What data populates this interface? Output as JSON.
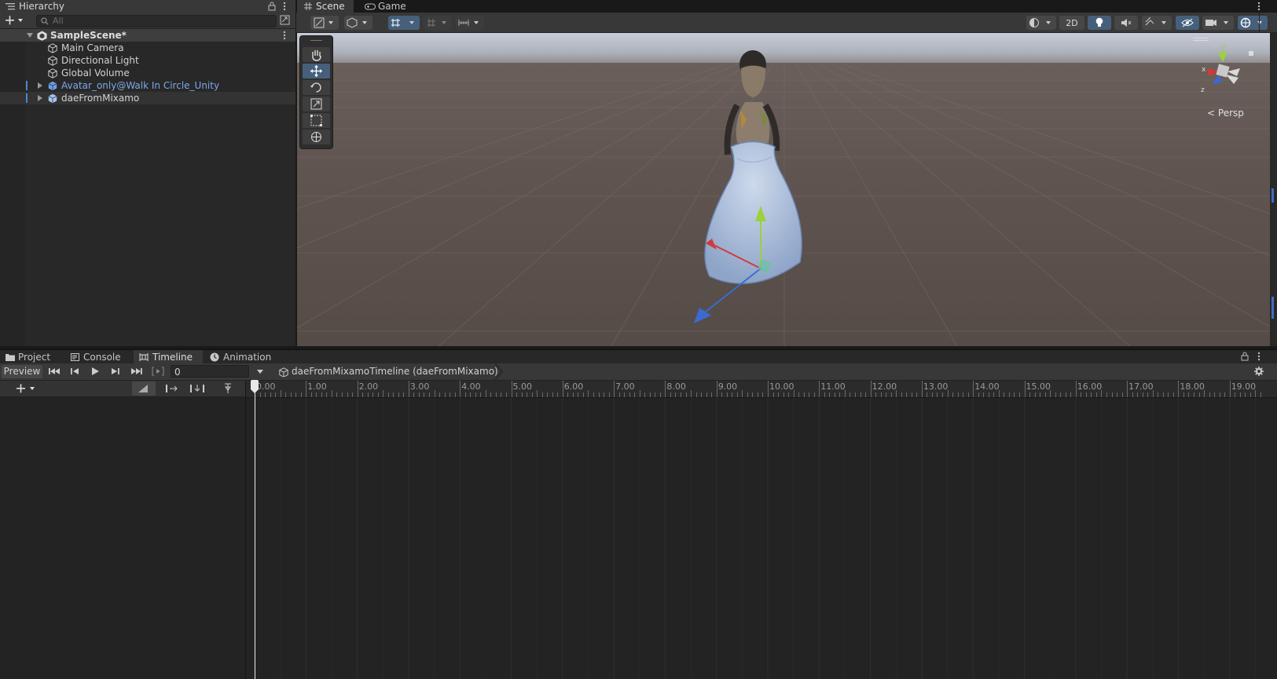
{
  "hierarchy": {
    "title": "Hierarchy",
    "search_placeholder": "All",
    "scene_name": "SampleScene*",
    "items": [
      {
        "label": "Main Camera",
        "style": "normal"
      },
      {
        "label": "Directional Light",
        "style": "normal"
      },
      {
        "label": "Global Volume",
        "style": "normal"
      },
      {
        "label": "Avatar_only@Walk In Circle_Unity",
        "style": "prefab-blue"
      },
      {
        "label": "daeFromMixamo",
        "style": "selected"
      }
    ]
  },
  "scene": {
    "tabs": [
      {
        "label": "Scene",
        "icon": "grid-icon"
      },
      {
        "label": "Game",
        "icon": "gamepad-icon"
      }
    ],
    "toolbar_2d_label": "2D",
    "gizmo_projection_label": "Persp",
    "gizmo_axes": [
      "y",
      "x",
      "z"
    ],
    "tools": [
      "hand-tool",
      "move-tool",
      "rotate-tool",
      "scale-tool",
      "rect-tool",
      "transform-tool"
    ],
    "active_tool": "move-tool"
  },
  "bottom": {
    "tabs": [
      {
        "label": "Project",
        "icon": "folder-icon"
      },
      {
        "label": "Console",
        "icon": "console-icon"
      },
      {
        "label": "Timeline",
        "icon": "timeline-icon"
      },
      {
        "label": "Animation",
        "icon": "animation-icon"
      }
    ],
    "active_tab": "Timeline"
  },
  "timeline": {
    "preview_label": "Preview",
    "frame_value": "0",
    "breadcrumb": "daeFromMixamoTimeline (daeFromMixamo)",
    "ruler_labels": [
      "0.00",
      "1.00",
      "2.00",
      "3.00",
      "4.00",
      "5.00",
      "6.00",
      "7.00",
      "8.00",
      "9.00",
      "10.00",
      "11.00",
      "12.00",
      "13.00",
      "14.00",
      "15.00",
      "16.00",
      "17.00",
      "18.00",
      "19.00"
    ],
    "playhead_time": 0
  },
  "colors": {
    "accent_blue": "#46607c",
    "prefab_text": "#7ba8e6",
    "axis_x": "#d23a3a",
    "axis_y": "#9bd13a",
    "axis_z": "#3a6bd2"
  }
}
